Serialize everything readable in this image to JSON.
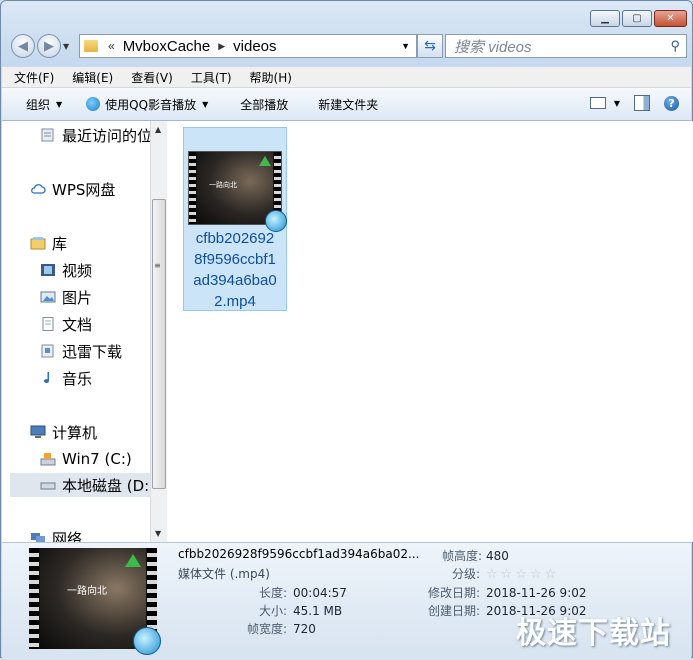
{
  "address": {
    "chevron": "«",
    "segments": [
      "MvboxCache",
      "videos"
    ]
  },
  "search": {
    "placeholder": "搜索 videos"
  },
  "menu": [
    "文件(F)",
    "编辑(E)",
    "查看(V)",
    "工具(T)",
    "帮助(H)"
  ],
  "toolbar": {
    "organize": "组织",
    "qq_play": "使用QQ影音播放",
    "play_all": "全部播放",
    "new_folder": "新建文件夹"
  },
  "nav": {
    "recent": "最近访问的位",
    "wps": "WPS网盘",
    "library": "库",
    "videos": "视频",
    "pictures": "图片",
    "documents": "文档",
    "xunlei": "迅雷下载",
    "music": "音乐",
    "computer": "计算机",
    "win7": "Win7 (C:)",
    "local_d": "本地磁盘 (D:",
    "network": "网络"
  },
  "file": {
    "name_lines": [
      "cfbb202692",
      "8f9596ccbf1",
      "ad394a6ba0",
      "2.mp4"
    ],
    "thumb_caption": "一路向北"
  },
  "details": {
    "name": "cfbb2026928f9596ccbf1ad394a6ba02...",
    "type": "媒体文件 (.mp4)",
    "length_label": "长度:",
    "length": "00:04:57",
    "size_label": "大小:",
    "size": "45.1 MB",
    "width_label": "帧宽度:",
    "width": "720",
    "height_label": "帧高度:",
    "height": "480",
    "rating_label": "分级:",
    "modified_label": "修改日期:",
    "modified": "2018-11-26 9:02",
    "created_label": "创建日期:",
    "created": "2018-11-26 9:02"
  },
  "watermark": "极速下载站"
}
